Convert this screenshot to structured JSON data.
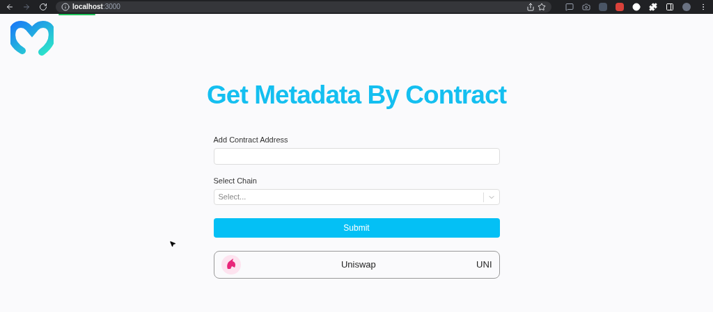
{
  "browser": {
    "url": "**localhost**:3000",
    "page_load": {
      "level": 0.075
    }
  },
  "page": {
    "title": "Get Metadata By Contract",
    "form": {
      "address_label": "Add Contract Address",
      "chain_label": "Select Chain",
      "chain_placeholder": "Select...",
      "submit": "Submit"
    },
    "result": {
      "name": "Uniswap",
      "symbol": "UNI"
    }
  }
}
